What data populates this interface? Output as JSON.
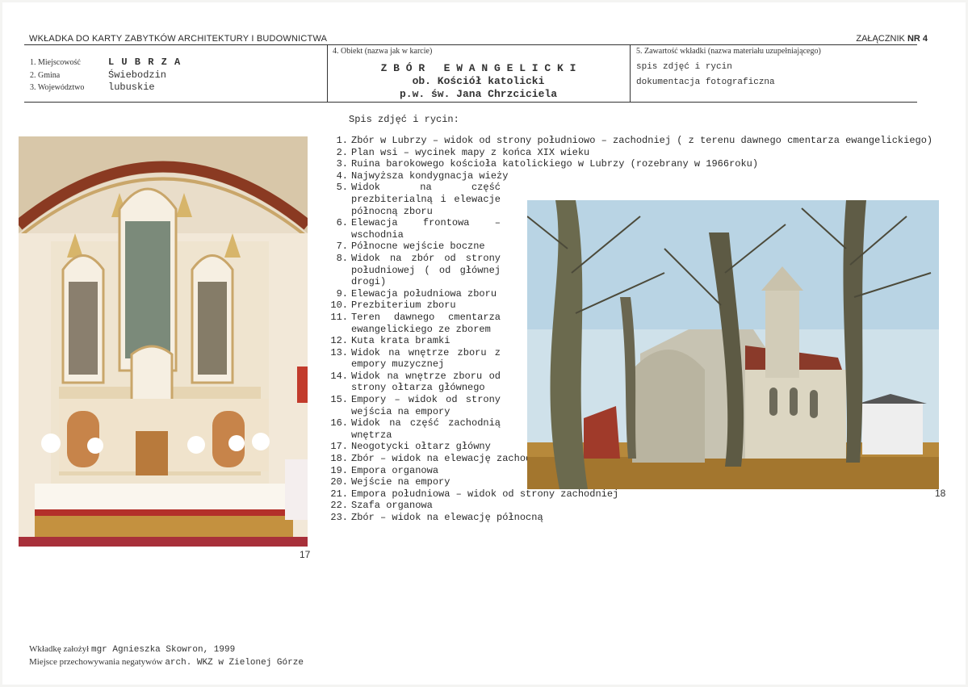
{
  "header": {
    "title": "WKŁADKA DO KARTY ZABYTKÓW ARCHITEKTURY I BUDOWNICTWA",
    "attachment_label": "ZAŁĄCZNIK",
    "attachment_number": "NR 4"
  },
  "table": {
    "left": {
      "labels": [
        "1. Miejscowość",
        "2. Gmina",
        "3. Województwo"
      ],
      "values": [
        "L U B R Z A",
        "Świebodzin",
        "lubuskie"
      ]
    },
    "center": {
      "label": "4. Obiekt (nazwa jak w karcie)",
      "lines": [
        "Z B Ó R   E W A N G E L I C K I",
        "ob. Kościół katolicki",
        "p.w. św. Jana Chrzciciela"
      ]
    },
    "right": {
      "label": "5. Zawartość wkładki (nazwa materiału uzupełniającego)",
      "lines": [
        "spis zdjęć i rycin",
        "dokumentacja fotograficzna"
      ]
    }
  },
  "list_title": "Spis zdjęć i rycin:",
  "items": [
    {
      "n": "1.",
      "t": "Zbór w Lubrzy – widok od strony południowo – zachodniej ( z terenu dawnego cmentarza ewangelickiego)"
    },
    {
      "n": "2.",
      "t": "Plan wsi – wycinek mapy z końca XIX wieku"
    },
    {
      "n": "3.",
      "t": "Ruina barokowego kościoła katolickiego w Lubrzy (rozebrany w 1966roku)"
    },
    {
      "n": "4.",
      "t": "Najwyższa kondygnacja wieży"
    },
    {
      "n": "5.",
      "t": "Widok na część prezbiterialną i elewacje północną zboru"
    },
    {
      "n": "6.",
      "t": "Elewacja frontowa – wschodnia"
    },
    {
      "n": "7.",
      "t": "Północne wejście boczne"
    },
    {
      "n": "8.",
      "t": "Widok na zbór od strony południowej ( od głównej drogi)"
    },
    {
      "n": "9.",
      "t": "Elewacja południowa zboru"
    },
    {
      "n": "10.",
      "t": "Prezbiterium zboru"
    },
    {
      "n": "11.",
      "t": "Teren dawnego cmentarza ewangelickiego ze zborem"
    },
    {
      "n": "12.",
      "t": "Kuta krata bramki"
    },
    {
      "n": "13.",
      "t": "Widok na wnętrze zboru z empory muzycznej"
    },
    {
      "n": "14.",
      "t": "Widok na wnętrze zboru od strony ołtarza głównego"
    },
    {
      "n": "15.",
      "t": "Empory – widok od strony wejścia na empory"
    },
    {
      "n": "16.",
      "t": "Widok na część zachodnią wnętrza"
    },
    {
      "n": "17.",
      "t": "Neogotycki ołtarz główny"
    },
    {
      "n": "18.",
      "t": "Zbór – widok na elewację zachodnią i południową"
    },
    {
      "n": "19.",
      "t": "Empora organowa"
    },
    {
      "n": "20.",
      "t": "Wejście na empory"
    },
    {
      "n": "21.",
      "t": "Empora południowa – widok od strony zachodniej"
    },
    {
      "n": "22.",
      "t": "Szafa organowa"
    },
    {
      "n": "23.",
      "t": "Zbór – widok na elewację północną"
    }
  ],
  "photos": {
    "left_caption": "17",
    "right_caption": "18"
  },
  "footer": {
    "founded_label": "Wkładkę założył",
    "founded_value": "mgr Agnieszka Skowron, 1999",
    "storage_label": "Miejsce przechowywania negatywów",
    "storage_value": "arch. WKZ w Zielonej Górze"
  }
}
